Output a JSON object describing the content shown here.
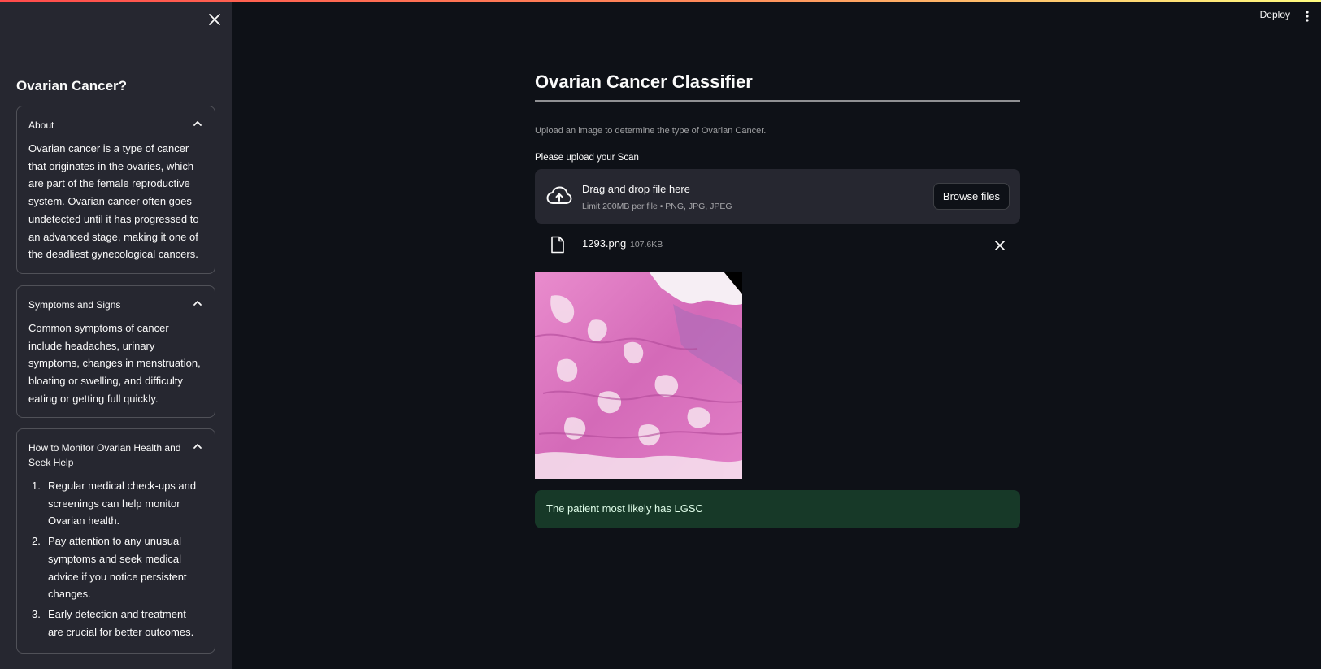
{
  "header": {
    "deploy_label": "Deploy",
    "menu_icon": "kebab-menu-icon"
  },
  "sidebar": {
    "title": "Ovarian Cancer?",
    "close_icon": "close-icon",
    "sections": [
      {
        "title": "About",
        "expanded": true,
        "body": "Ovarian cancer is a type of cancer that originates in the ovaries, which are part of the female reproductive system. Ovarian cancer often goes undetected until it has progressed to an advanced stage, making it one of the deadliest gynecological cancers."
      },
      {
        "title": "Symptoms and Signs",
        "expanded": true,
        "body": "Common symptoms of cancer include headaches, urinary symptoms, changes in menstruation, bloating or swelling, and difficulty eating or getting full quickly."
      },
      {
        "title": "How to Monitor Ovarian Health and Seek Help",
        "expanded": true,
        "items": [
          {
            "num": "1.",
            "text": "Regular medical check-ups and screenings can help monitor Ovarian health."
          },
          {
            "num": "2.",
            "text": "Pay attention to any unusual symptoms and seek medical advice if you notice persistent changes."
          },
          {
            "num": "3.",
            "text": "Early detection and treatment are crucial for better outcomes."
          }
        ]
      }
    ]
  },
  "main": {
    "title": "Ovarian Cancer Classifier",
    "caption": "Upload an image to determine the type of Ovarian Cancer.",
    "uploader": {
      "label": "Please upload your Scan",
      "drop_title": "Drag and drop file here",
      "limit_text": "Limit 200MB per file • PNG, JPG, JPEG",
      "browse_label": "Browse files"
    },
    "uploaded_file": {
      "name": "1293.png",
      "size": "107.6KB"
    },
    "result": "The patient most likely has LGSC"
  },
  "colors": {
    "background": "#0e1117",
    "sidebar": "#262730",
    "success_bg": "#173928",
    "success_text": "#dffde9"
  }
}
